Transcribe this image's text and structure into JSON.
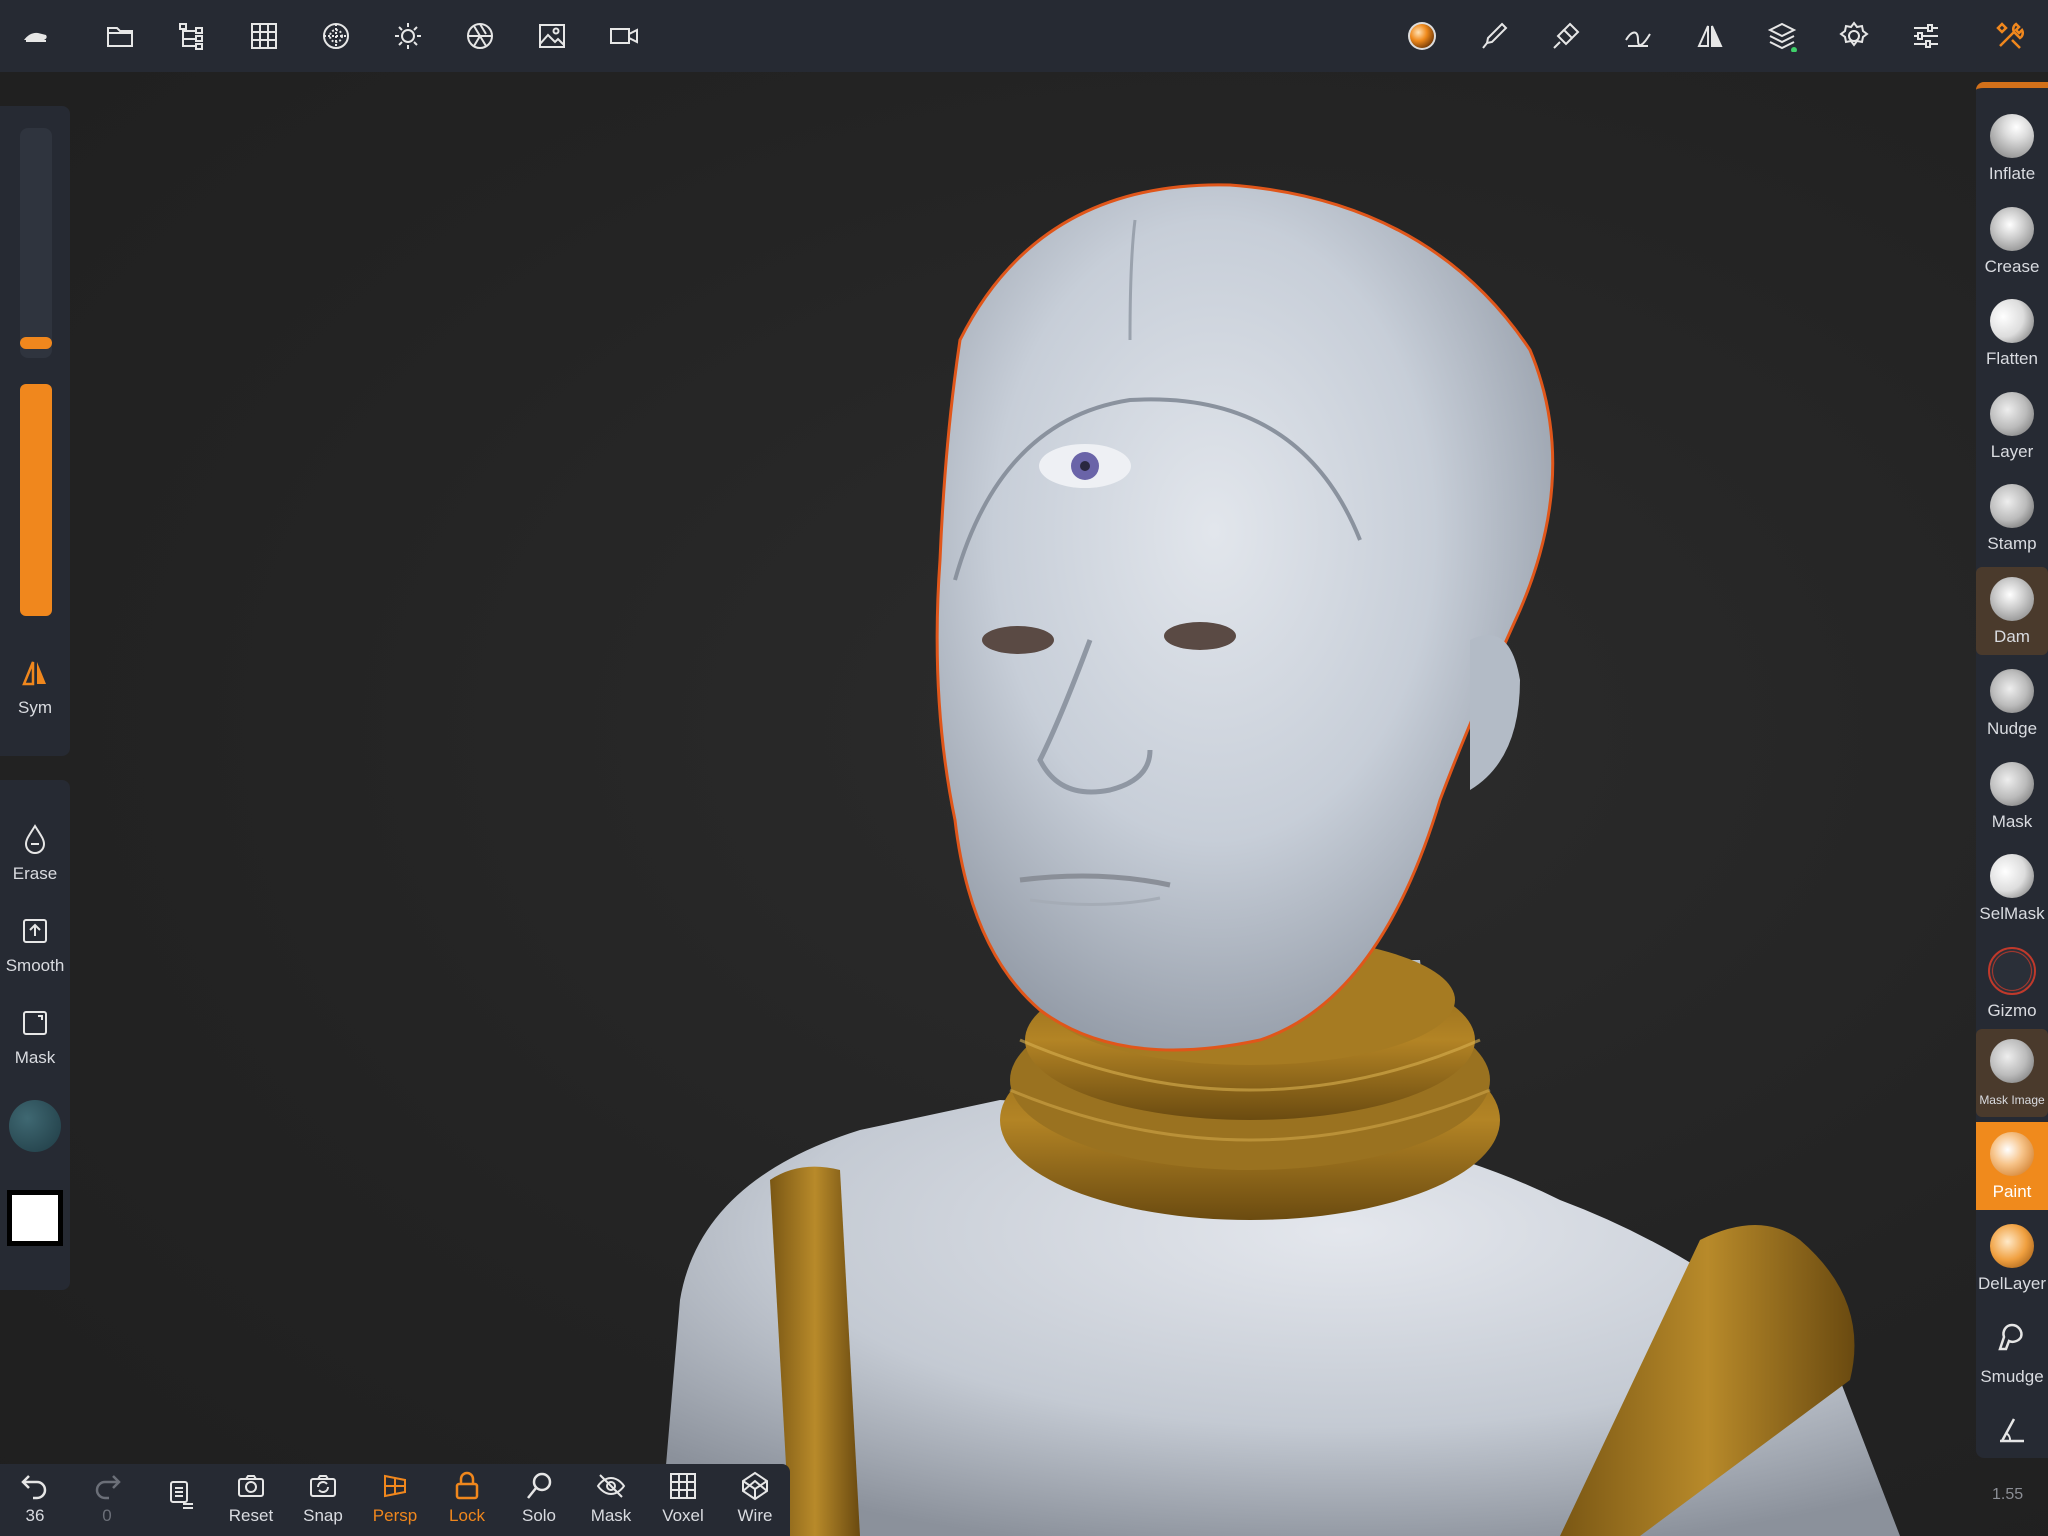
{
  "accent_color": "#f0871d",
  "topbar": {
    "left_icons": [
      "app-logo-icon",
      "folder-icon",
      "scene-tree-icon",
      "grid-icon",
      "matcap-icon",
      "light-icon",
      "camera-aperture-icon",
      "image-icon",
      "video-icon"
    ],
    "right_icons": [
      "material-sphere-icon",
      "brush-icon",
      "paint-brush-icon",
      "stroke-icon",
      "symmetry-icon",
      "layers-icon",
      "gear-icon",
      "sliders-icon",
      "tools-icon"
    ]
  },
  "left_panel": {
    "radius_slider_value": 0.04,
    "intensity_slider_value": 1.0,
    "sym_label": "Sym",
    "erase_label": "Erase",
    "smooth_label": "Smooth",
    "mask_label": "Mask"
  },
  "right_tools": [
    {
      "label": "Inflate",
      "state": "normal"
    },
    {
      "label": "Crease",
      "state": "normal"
    },
    {
      "label": "Flatten",
      "state": "normal"
    },
    {
      "label": "Layer",
      "state": "normal"
    },
    {
      "label": "Stamp",
      "state": "normal"
    },
    {
      "label": "Dam",
      "state": "selected"
    },
    {
      "label": "Nudge",
      "state": "normal"
    },
    {
      "label": "Mask",
      "state": "normal"
    },
    {
      "label": "SelMask",
      "state": "normal"
    },
    {
      "label": "Gizmo",
      "state": "normal"
    },
    {
      "label": "Mask Image",
      "state": "selected"
    },
    {
      "label": "Paint",
      "state": "active"
    },
    {
      "label": "DelLayer",
      "state": "normal"
    },
    {
      "label": "Smudge",
      "state": "normal"
    }
  ],
  "bottombar": {
    "undo_count": "36",
    "redo_count": "0",
    "reset_label": "Reset",
    "snap_label": "Snap",
    "persp_label": "Persp",
    "lock_label": "Lock",
    "solo_label": "Solo",
    "mask_label": "Mask",
    "voxel_label": "Voxel",
    "wire_label": "Wire"
  },
  "zoom_level": "1.55"
}
